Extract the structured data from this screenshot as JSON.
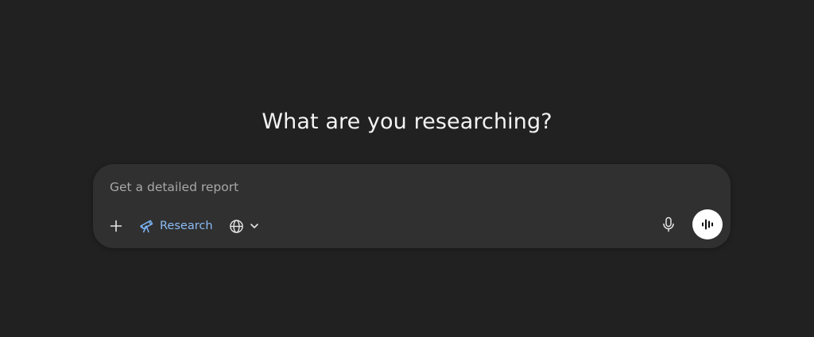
{
  "main": {
    "heading": "What are you researching?"
  },
  "composer": {
    "placeholder": "Get a detailed report",
    "value": "",
    "tools": {
      "add_icon": "plus-icon",
      "research_icon": "telescope-icon",
      "research_label": "Research",
      "web_icon": "globe-icon",
      "web_dropdown_icon": "chevron-down-icon",
      "mic_icon": "microphone-icon",
      "voice_icon": "voice-waveform-icon"
    }
  },
  "colors": {
    "background": "#212121",
    "composer": "#303030",
    "research_accent": "#7ab3f4",
    "voice_button": "#ffffff"
  }
}
